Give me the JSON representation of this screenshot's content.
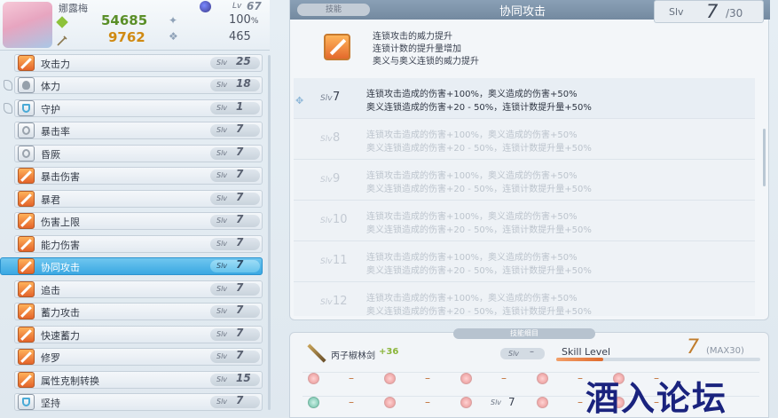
{
  "character": {
    "name": "娜露梅",
    "level_label": "Lv",
    "level": "67",
    "hp": "54685",
    "atk": "9762",
    "stat_pct": "100",
    "stat_pct_unit": "%",
    "stat_power": "465"
  },
  "skills": [
    {
      "name": "攻击力",
      "slv_label": "Slv",
      "slv": "25",
      "icon": "atk-sword-icon"
    },
    {
      "name": "体力",
      "slv_label": "Slv",
      "slv": "18",
      "icon": "heart-icon"
    },
    {
      "name": "守护",
      "slv_label": "Slv",
      "slv": "1",
      "icon": "shield-icon"
    },
    {
      "name": "暴击率",
      "slv_label": "Slv",
      "slv": "7",
      "icon": "gear-icon"
    },
    {
      "name": "昏厥",
      "slv_label": "Slv",
      "slv": "7",
      "icon": "gear-icon"
    },
    {
      "name": "暴击伤害",
      "slv_label": "Slv",
      "slv": "7",
      "icon": "sword-icon"
    },
    {
      "name": "暴君",
      "slv_label": "Slv",
      "slv": "7",
      "icon": "sword-icon"
    },
    {
      "name": "伤害上限",
      "slv_label": "Slv",
      "slv": "7",
      "icon": "sword-icon"
    },
    {
      "name": "能力伤害",
      "slv_label": "Slv",
      "slv": "7",
      "icon": "sword-icon"
    },
    {
      "name": "协同攻击",
      "slv_label": "Slv",
      "slv": "7",
      "icon": "sword-icon",
      "selected": true
    },
    {
      "name": "追击",
      "slv_label": "Slv",
      "slv": "7",
      "icon": "sword-icon"
    },
    {
      "name": "蓄力攻击",
      "slv_label": "Slv",
      "slv": "7",
      "icon": "sword-icon"
    },
    {
      "name": "快速蓄力",
      "slv_label": "Slv",
      "slv": "7",
      "icon": "sword-icon"
    },
    {
      "name": "修罗",
      "slv_label": "Slv",
      "slv": "7",
      "icon": "sword-icon"
    },
    {
      "name": "属性克制转换",
      "slv_label": "Slv",
      "slv": "15",
      "icon": "sword-icon"
    },
    {
      "name": "坚持",
      "slv_label": "Slv",
      "slv": "7",
      "icon": "shield-icon"
    }
  ],
  "detail": {
    "tag": "技能",
    "title": "协同攻击",
    "slv_label": "Slv",
    "slv": "7",
    "slv_max": "/30",
    "summary": [
      "连锁攻击的威力提升",
      "连锁计数的提升量增加",
      "奥义与奥义连锁的威力提升"
    ],
    "levels": [
      {
        "slv_label": "Slv",
        "level": "7",
        "line1": "连锁攻击造成的伤害+100%，奥义造成的伤害+50%",
        "line2": "奥义连锁造成的伤害+20 - 50%，连锁计数提升量+50%"
      },
      {
        "slv_label": "Slv",
        "level": "8",
        "line1": "连锁攻击造成的伤害+100%，奥义造成的伤害+50%",
        "line2": "奥义连锁造成的伤害+20 - 50%，连锁计数提升量+50%"
      },
      {
        "slv_label": "Slv",
        "level": "9",
        "line1": "连锁攻击造成的伤害+100%，奥义造成的伤害+50%",
        "line2": "奥义连锁造成的伤害+20 - 50%，连锁计数提升量+50%"
      },
      {
        "slv_label": "Slv",
        "level": "10",
        "line1": "连锁攻击造成的伤害+100%，奥义造成的伤害+50%",
        "line2": "奥义连锁造成的伤害+20 - 50%，连锁计数提升量+50%"
      },
      {
        "slv_label": "Slv",
        "level": "11",
        "line1": "连锁攻击造成的伤害+100%，奥义造成的伤害+50%",
        "line2": "奥义连锁造成的伤害+20 - 50%，连锁计数提升量+50%"
      },
      {
        "slv_label": "Slv",
        "level": "12",
        "line1": "连锁攻击造成的伤害+100%，奥义造成的伤害+50%",
        "line2": "奥义连锁造成的伤害+20 - 50%，连锁计数提升量+50%"
      }
    ]
  },
  "skill_detail": {
    "tab": "技能细目",
    "weapon_name": "丙子椒林剑",
    "weapon_bonus": "+36",
    "slv_label": "Slv",
    "slv": "–",
    "skill_level_label": "Skill Level",
    "skill_level": "7",
    "skill_level_max": "MAX30",
    "skill_level_fraction": 0.23,
    "slots_row1": [
      {
        "val": "–"
      },
      {
        "val": "–"
      },
      {
        "val": "–"
      },
      {
        "val": "–"
      },
      {
        "val": "–"
      }
    ],
    "slots_row2": [
      {
        "val": "–"
      },
      {
        "val": "–"
      },
      {
        "slv_label": "Slv",
        "val": "7"
      },
      {
        "val": "–"
      },
      {
        "val": "–"
      }
    ]
  },
  "watermark": "酒入论坛"
}
